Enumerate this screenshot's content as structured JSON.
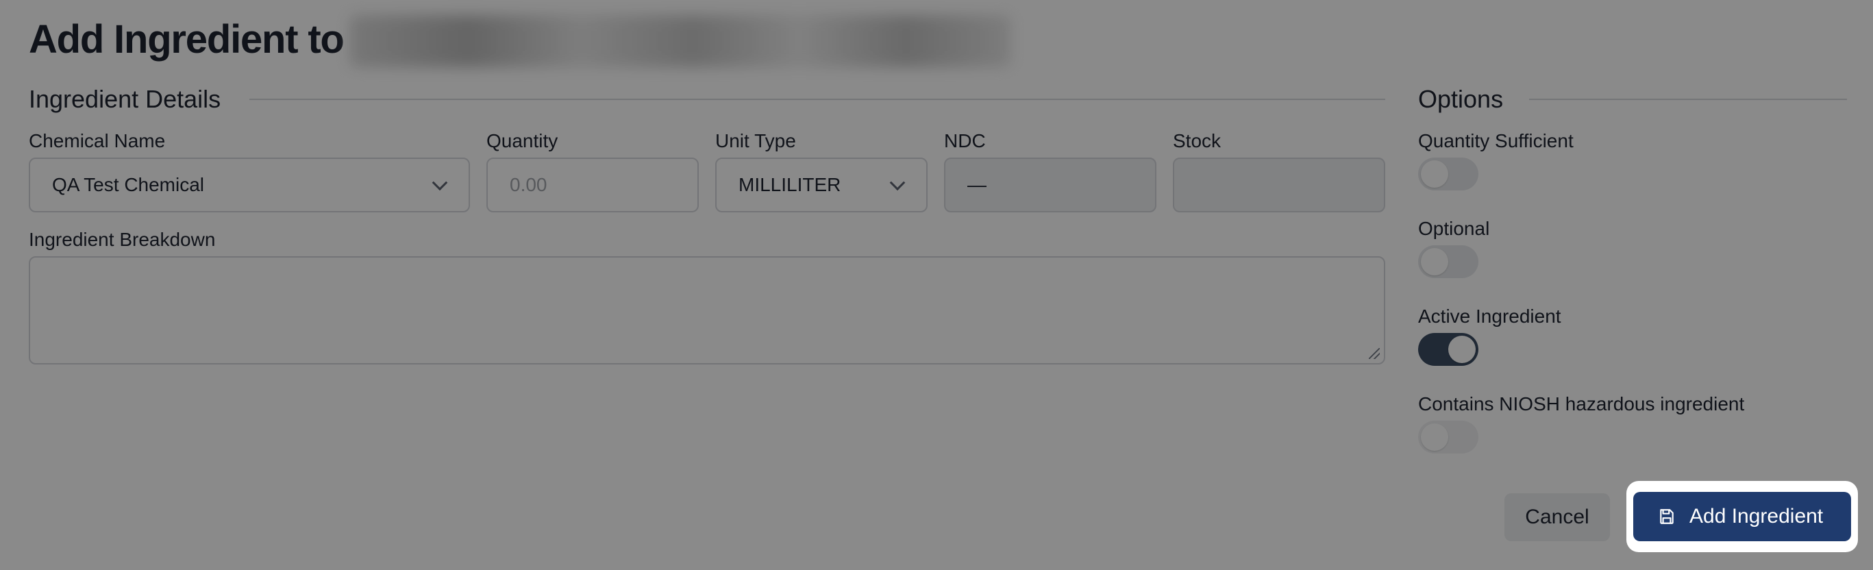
{
  "header": {
    "title": "Add Ingredient to"
  },
  "details": {
    "section_title": "Ingredient Details",
    "chemical_name": {
      "label": "Chemical Name",
      "value": "QA Test Chemical"
    },
    "quantity": {
      "label": "Quantity",
      "placeholder": "0.00"
    },
    "unit_type": {
      "label": "Unit Type",
      "value": "MILLILITER"
    },
    "ndc": {
      "label": "NDC",
      "value": "—"
    },
    "stock": {
      "label": "Stock",
      "value": ""
    },
    "breakdown": {
      "label": "Ingredient Breakdown",
      "value": ""
    }
  },
  "options": {
    "section_title": "Options",
    "toggles": [
      {
        "label": "Quantity Sufficient",
        "on": false
      },
      {
        "label": "Optional",
        "on": false
      },
      {
        "label": "Active Ingredient",
        "on": true
      },
      {
        "label": "Contains NIOSH hazardous ingredient",
        "on": false
      }
    ]
  },
  "actions": {
    "cancel_label": "Cancel",
    "add_label": "Add Ingredient",
    "add_icon": "save-icon"
  },
  "colors": {
    "primary": "#1f3b6e",
    "toggle_on": "#3b4c63",
    "overlay": "rgba(0,0,0,0.46)"
  }
}
